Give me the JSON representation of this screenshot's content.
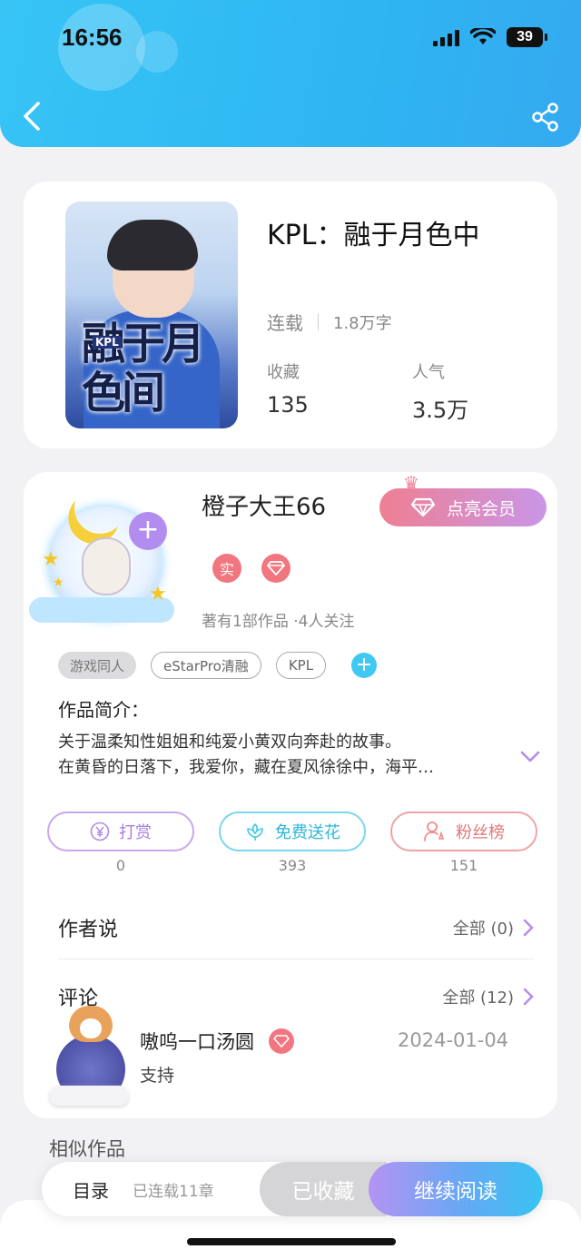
{
  "status_bar": {
    "time": "16:56",
    "battery": "39"
  },
  "book": {
    "title": "KPL：融于月色中",
    "cover_title": "融于月色间",
    "cover_tag": "KPL",
    "status": "连载",
    "word_count": "1.8万字",
    "favorites_label": "收藏",
    "favorites_value": "135",
    "popularity_label": "人气",
    "popularity_value": "3.5万"
  },
  "author": {
    "name": "橙子大王66",
    "vip_button": "点亮会员",
    "badge_real": "实",
    "info": "著有1部作品 ·4人关注"
  },
  "tags": [
    "游戏同人",
    "eStarPro清融",
    "KPL"
  ],
  "intro": {
    "title": "作品简介：",
    "line1": "关于温柔知性姐姐和纯爱小黄双向奔赴的故事。",
    "line2": "在黄昏的日落下，我爱你，藏在夏风徐徐中，海平…"
  },
  "actions": {
    "reward": {
      "label": "打赏",
      "count": "0",
      "color": "#b389e6"
    },
    "flower": {
      "label": "免费送花",
      "count": "393",
      "color": "#3fc8e8"
    },
    "fans": {
      "label": "粉丝榜",
      "count": "151",
      "color": "#ef8a8a"
    }
  },
  "author_says": {
    "title": "作者说",
    "more": "全部 (0)"
  },
  "comments": {
    "title": "评论",
    "more": "全部 (12)",
    "items": [
      {
        "user": "嗷呜一口汤圆",
        "date": "2024-01-04",
        "text": "支持"
      }
    ]
  },
  "similar_title": "相似作品",
  "bottom_bar": {
    "toc_label": "目录",
    "chapters": "已连载11章",
    "collected": "已收藏",
    "continue": "继续阅读"
  },
  "colors": {
    "header": "#2eb6f2",
    "accent_purple": "#b38cf0",
    "accent_red": "#f2767f"
  }
}
